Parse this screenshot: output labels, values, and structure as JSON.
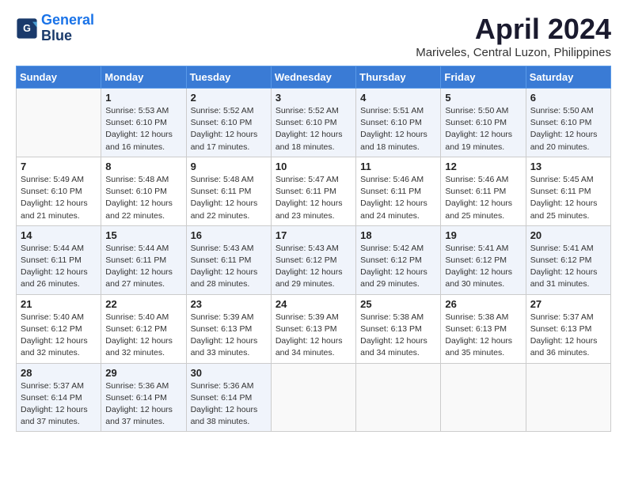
{
  "logo": {
    "line1": "General",
    "line2": "Blue"
  },
  "title": "April 2024",
  "location": "Mariveles, Central Luzon, Philippines",
  "days_header": [
    "Sunday",
    "Monday",
    "Tuesday",
    "Wednesday",
    "Thursday",
    "Friday",
    "Saturday"
  ],
  "weeks": [
    [
      {
        "day": "",
        "text": ""
      },
      {
        "day": "1",
        "text": "Sunrise: 5:53 AM\nSunset: 6:10 PM\nDaylight: 12 hours\nand 16 minutes."
      },
      {
        "day": "2",
        "text": "Sunrise: 5:52 AM\nSunset: 6:10 PM\nDaylight: 12 hours\nand 17 minutes."
      },
      {
        "day": "3",
        "text": "Sunrise: 5:52 AM\nSunset: 6:10 PM\nDaylight: 12 hours\nand 18 minutes."
      },
      {
        "day": "4",
        "text": "Sunrise: 5:51 AM\nSunset: 6:10 PM\nDaylight: 12 hours\nand 18 minutes."
      },
      {
        "day": "5",
        "text": "Sunrise: 5:50 AM\nSunset: 6:10 PM\nDaylight: 12 hours\nand 19 minutes."
      },
      {
        "day": "6",
        "text": "Sunrise: 5:50 AM\nSunset: 6:10 PM\nDaylight: 12 hours\nand 20 minutes."
      }
    ],
    [
      {
        "day": "7",
        "text": "Sunrise: 5:49 AM\nSunset: 6:10 PM\nDaylight: 12 hours\nand 21 minutes."
      },
      {
        "day": "8",
        "text": "Sunrise: 5:48 AM\nSunset: 6:10 PM\nDaylight: 12 hours\nand 22 minutes."
      },
      {
        "day": "9",
        "text": "Sunrise: 5:48 AM\nSunset: 6:11 PM\nDaylight: 12 hours\nand 22 minutes."
      },
      {
        "day": "10",
        "text": "Sunrise: 5:47 AM\nSunset: 6:11 PM\nDaylight: 12 hours\nand 23 minutes."
      },
      {
        "day": "11",
        "text": "Sunrise: 5:46 AM\nSunset: 6:11 PM\nDaylight: 12 hours\nand 24 minutes."
      },
      {
        "day": "12",
        "text": "Sunrise: 5:46 AM\nSunset: 6:11 PM\nDaylight: 12 hours\nand 25 minutes."
      },
      {
        "day": "13",
        "text": "Sunrise: 5:45 AM\nSunset: 6:11 PM\nDaylight: 12 hours\nand 25 minutes."
      }
    ],
    [
      {
        "day": "14",
        "text": "Sunrise: 5:44 AM\nSunset: 6:11 PM\nDaylight: 12 hours\nand 26 minutes."
      },
      {
        "day": "15",
        "text": "Sunrise: 5:44 AM\nSunset: 6:11 PM\nDaylight: 12 hours\nand 27 minutes."
      },
      {
        "day": "16",
        "text": "Sunrise: 5:43 AM\nSunset: 6:11 PM\nDaylight: 12 hours\nand 28 minutes."
      },
      {
        "day": "17",
        "text": "Sunrise: 5:43 AM\nSunset: 6:12 PM\nDaylight: 12 hours\nand 29 minutes."
      },
      {
        "day": "18",
        "text": "Sunrise: 5:42 AM\nSunset: 6:12 PM\nDaylight: 12 hours\nand 29 minutes."
      },
      {
        "day": "19",
        "text": "Sunrise: 5:41 AM\nSunset: 6:12 PM\nDaylight: 12 hours\nand 30 minutes."
      },
      {
        "day": "20",
        "text": "Sunrise: 5:41 AM\nSunset: 6:12 PM\nDaylight: 12 hours\nand 31 minutes."
      }
    ],
    [
      {
        "day": "21",
        "text": "Sunrise: 5:40 AM\nSunset: 6:12 PM\nDaylight: 12 hours\nand 32 minutes."
      },
      {
        "day": "22",
        "text": "Sunrise: 5:40 AM\nSunset: 6:12 PM\nDaylight: 12 hours\nand 32 minutes."
      },
      {
        "day": "23",
        "text": "Sunrise: 5:39 AM\nSunset: 6:13 PM\nDaylight: 12 hours\nand 33 minutes."
      },
      {
        "day": "24",
        "text": "Sunrise: 5:39 AM\nSunset: 6:13 PM\nDaylight: 12 hours\nand 34 minutes."
      },
      {
        "day": "25",
        "text": "Sunrise: 5:38 AM\nSunset: 6:13 PM\nDaylight: 12 hours\nand 34 minutes."
      },
      {
        "day": "26",
        "text": "Sunrise: 5:38 AM\nSunset: 6:13 PM\nDaylight: 12 hours\nand 35 minutes."
      },
      {
        "day": "27",
        "text": "Sunrise: 5:37 AM\nSunset: 6:13 PM\nDaylight: 12 hours\nand 36 minutes."
      }
    ],
    [
      {
        "day": "28",
        "text": "Sunrise: 5:37 AM\nSunset: 6:14 PM\nDaylight: 12 hours\nand 37 minutes."
      },
      {
        "day": "29",
        "text": "Sunrise: 5:36 AM\nSunset: 6:14 PM\nDaylight: 12 hours\nand 37 minutes."
      },
      {
        "day": "30",
        "text": "Sunrise: 5:36 AM\nSunset: 6:14 PM\nDaylight: 12 hours\nand 38 minutes."
      },
      {
        "day": "",
        "text": ""
      },
      {
        "day": "",
        "text": ""
      },
      {
        "day": "",
        "text": ""
      },
      {
        "day": "",
        "text": ""
      }
    ]
  ]
}
